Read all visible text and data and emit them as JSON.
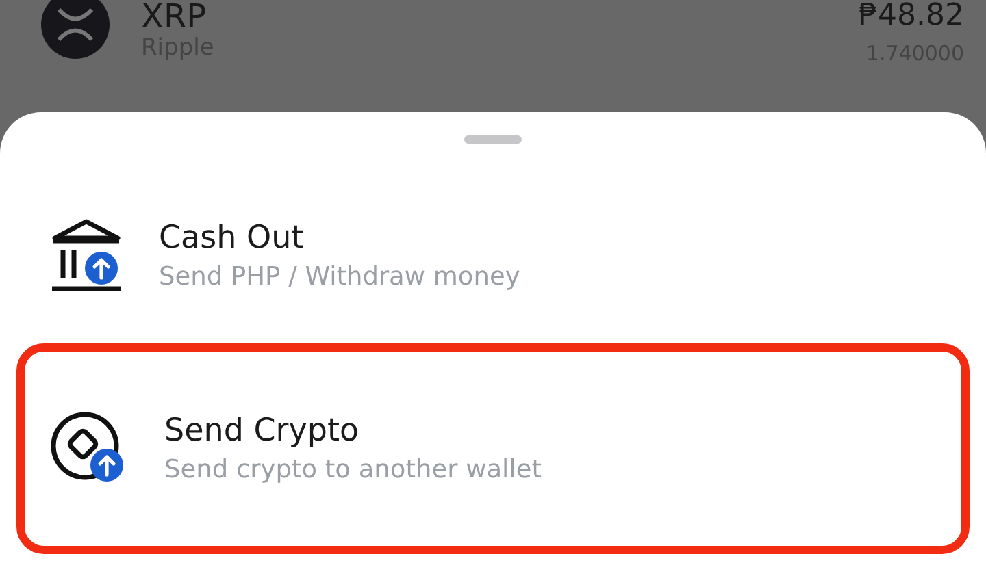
{
  "asset_row": {
    "symbol": "XRP",
    "name": "Ripple",
    "value": "₱48.82",
    "amount": "1.740000"
  },
  "sheet": {
    "options": [
      {
        "kind": "bank",
        "title": "Cash Out",
        "subtitle": "Send PHP / Withdraw money",
        "highlighted": false
      },
      {
        "kind": "crypto",
        "title": "Send Crypto",
        "subtitle": "Send crypto to another wallet",
        "highlighted": true
      }
    ]
  }
}
